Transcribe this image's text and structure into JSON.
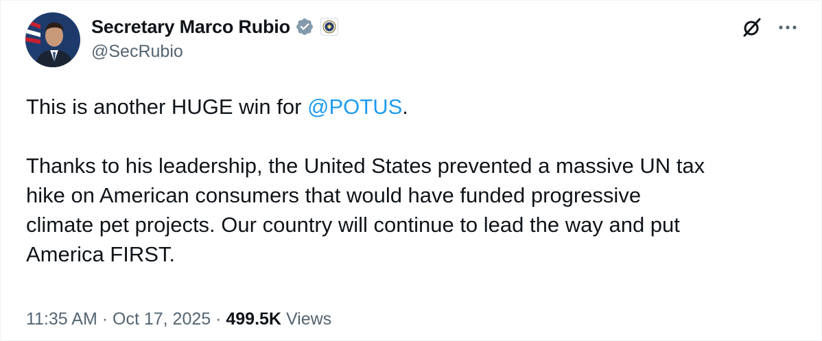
{
  "author": {
    "display_name": "Secretary Marco Rubio",
    "handle": "@SecRubio",
    "verified_badge_icon": "verified-badge-icon",
    "affiliation_icon": "state-department-seal-icon",
    "verified_color": "#829aab"
  },
  "tweet": {
    "line1_before_mention": "This is another HUGE win for ",
    "mention": "@POTUS",
    "line1_after_mention": ".",
    "paragraph2_lines": [
      "Thanks to his leadership, the United States prevented a massive UN tax",
      "hike on American consumers that would have funded progressive",
      "climate pet projects. Our country will continue to lead the way and put",
      "America FIRST."
    ]
  },
  "meta": {
    "time": "11:35 AM",
    "separator": " · ",
    "date": "Oct 17, 2025",
    "views_count": "499.5K",
    "views_label": " Views"
  },
  "actions": {
    "grok_icon": "grok-icon",
    "more_icon": "more-options-icon"
  },
  "colors": {
    "link_blue": "#1d9bf0",
    "text_primary": "#0f1419",
    "text_secondary": "#536471"
  }
}
